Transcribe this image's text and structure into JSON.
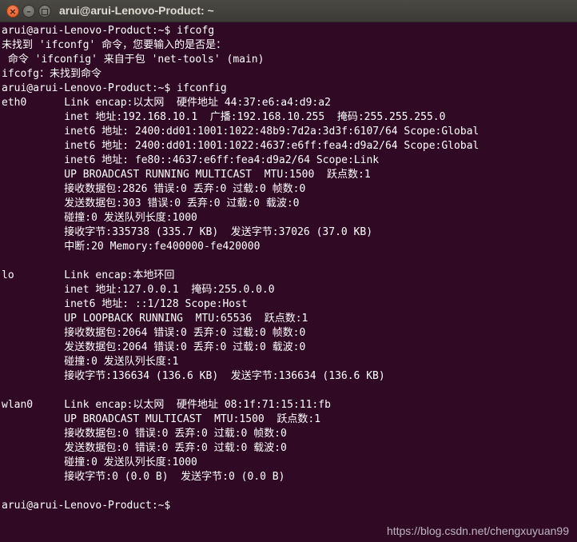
{
  "window": {
    "title": "arui@arui-Lenovo-Product: ~",
    "close_glyph": "×",
    "minimize_glyph": "–"
  },
  "terminal": {
    "lines": [
      "arui@arui-Lenovo-Product:~$ ifcofg",
      "未找到 'ifconfg' 命令，您要输入的是否是：",
      " 命令 'ifconfig' 来自于包 'net-tools' (main)",
      "ifcofg：未找到命令",
      "arui@arui-Lenovo-Product:~$ ifconfig",
      "eth0      Link encap:以太网  硬件地址 44:37:e6:a4:d9:a2",
      "          inet 地址:192.168.10.1  广播:192.168.10.255  掩码:255.255.255.0",
      "          inet6 地址: 2400:dd01:1001:1022:48b9:7d2a:3d3f:6107/64 Scope:Global",
      "          inet6 地址: 2400:dd01:1001:1022:4637:e6ff:fea4:d9a2/64 Scope:Global",
      "          inet6 地址: fe80::4637:e6ff:fea4:d9a2/64 Scope:Link",
      "          UP BROADCAST RUNNING MULTICAST  MTU:1500  跃点数:1",
      "          接收数据包:2826 错误:0 丢弃:0 过载:0 帧数:0",
      "          发送数据包:303 错误:0 丢弃:0 过载:0 载波:0",
      "          碰撞:0 发送队列长度:1000",
      "          接收字节:335738 (335.7 KB)  发送字节:37026 (37.0 KB)",
      "          中断:20 Memory:fe400000-fe420000",
      "",
      "lo        Link encap:本地环回",
      "          inet 地址:127.0.0.1  掩码:255.0.0.0",
      "          inet6 地址: ::1/128 Scope:Host",
      "          UP LOOPBACK RUNNING  MTU:65536  跃点数:1",
      "          接收数据包:2064 错误:0 丢弃:0 过载:0 帧数:0",
      "          发送数据包:2064 错误:0 丢弃:0 过载:0 载波:0",
      "          碰撞:0 发送队列长度:1",
      "          接收字节:136634 (136.6 KB)  发送字节:136634 (136.6 KB)",
      "",
      "wlan0     Link encap:以太网  硬件地址 08:1f:71:15:11:fb",
      "          UP BROADCAST MULTICAST  MTU:1500  跃点数:1",
      "          接收数据包:0 错误:0 丢弃:0 过载:0 帧数:0",
      "          发送数据包:0 错误:0 丢弃:0 过载:0 载波:0",
      "          碰撞:0 发送队列长度:1000",
      "          接收字节:0 (0.0 B)  发送字节:0 (0.0 B)",
      "",
      "arui@arui-Lenovo-Product:~$"
    ]
  },
  "watermark": "https://blog.csdn.net/chengxuyuan99",
  "colors": {
    "background": "#300a24",
    "text": "#ffffff",
    "titlebar": "#3c3b37",
    "close_button": "#e95420"
  }
}
